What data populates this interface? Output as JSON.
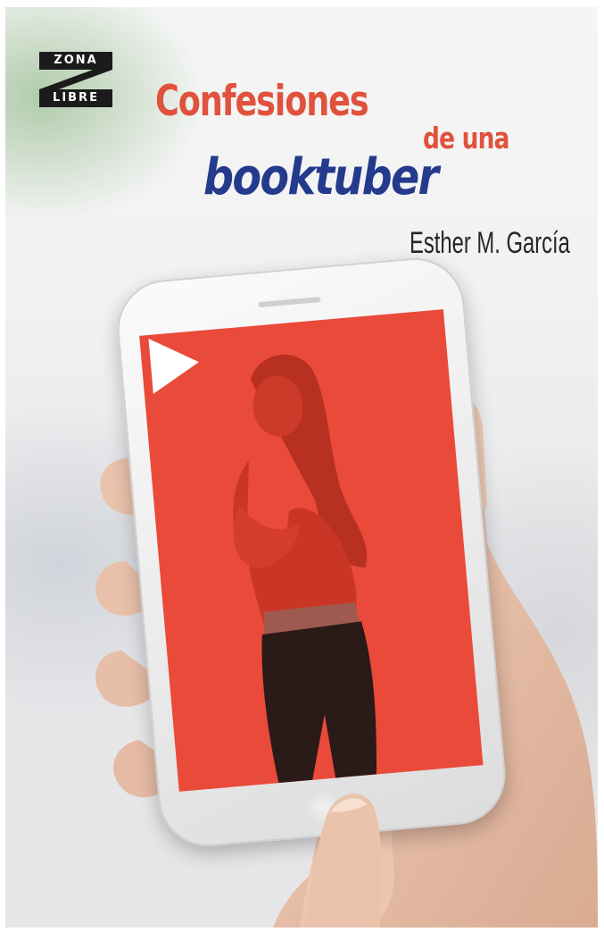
{
  "cover": {
    "publisher_logo": {
      "top": "ZONA",
      "bottom": "LIBRE"
    },
    "title": {
      "part1": "Confesiones",
      "part2": "de una",
      "part3": "booktuber"
    },
    "author": "Esther M. García",
    "colors": {
      "title_red": "#e0523d",
      "title_blue": "#233a8d",
      "screen_red": "#ea4a3a"
    },
    "icons": [
      "play-icon"
    ]
  }
}
